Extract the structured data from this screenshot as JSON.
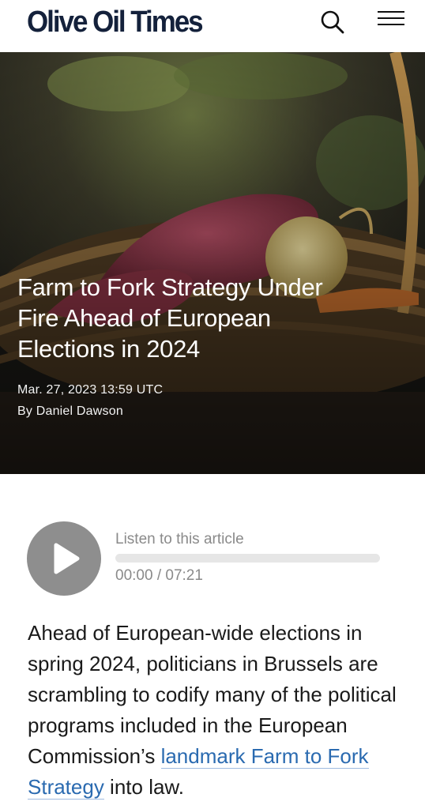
{
  "header": {
    "logo_text": "Olive Oil Times",
    "search_icon": "search-icon",
    "menu_icon": "hamburger-menu-icon"
  },
  "hero": {
    "title": "Farm to Fork Strategy Under Fire Ahead of European Elections in 2024",
    "date": "Mar. 27, 2023 13:59 UTC",
    "byline": "By Daniel Dawson"
  },
  "player": {
    "play_icon": "play-icon",
    "label": "Listen to this article",
    "time": "00:00 / 07:21",
    "progress": 0
  },
  "article": {
    "intro_before_link": "Ahead of European-wide elections in spring 2024, politicians in Brussels are scrambling to codify many of the political programs included in the European Commission’s ",
    "link_text": "landmark Farm to Fork Strategy",
    "intro_after_link": " into law."
  },
  "colors": {
    "logo": "#14213b",
    "link": "#2a6ab0",
    "play_button": "#8e8e8e",
    "muted_text": "#8a8a8a"
  }
}
